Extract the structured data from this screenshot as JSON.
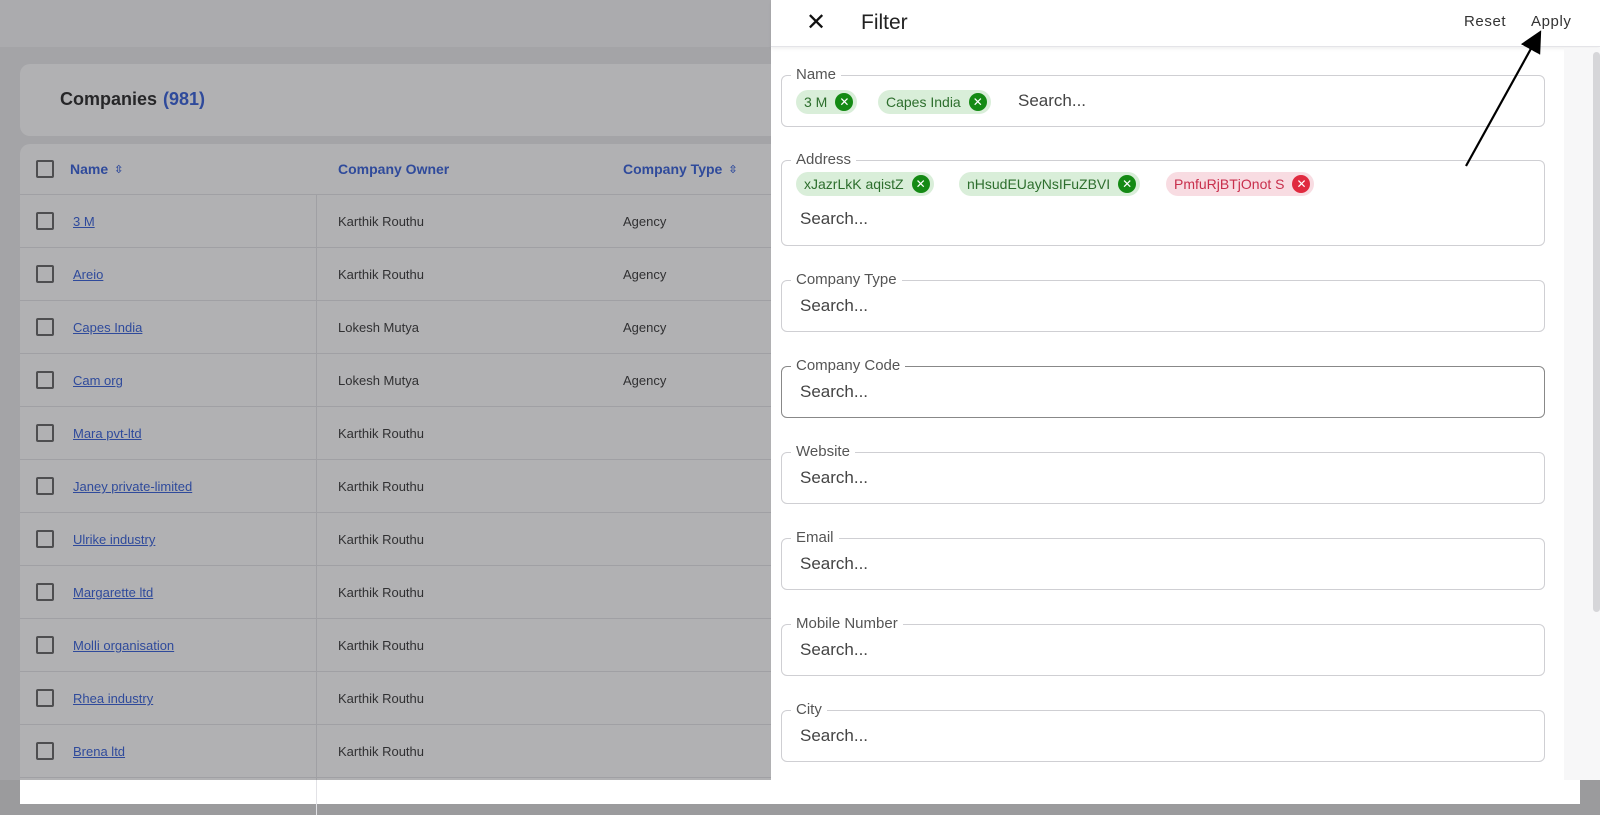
{
  "companies": {
    "title": "Companies",
    "count": "(981)",
    "columns": {
      "name": "Name",
      "owner": "Company Owner",
      "type": "Company Type"
    },
    "rows": [
      {
        "name": "3 M",
        "owner": "Karthik Routhu",
        "type": "Agency"
      },
      {
        "name": "Areio",
        "owner": "Karthik Routhu",
        "type": "Agency"
      },
      {
        "name": "Capes India",
        "owner": "Lokesh Mutya",
        "type": "Agency"
      },
      {
        "name": "Cam org",
        "owner": "Lokesh Mutya",
        "type": "Agency"
      },
      {
        "name": "Mara pvt-ltd",
        "owner": "Karthik Routhu",
        "type": ""
      },
      {
        "name": "Janey private-limited",
        "owner": "Karthik Routhu",
        "type": ""
      },
      {
        "name": "Ulrike industry",
        "owner": "Karthik Routhu",
        "type": ""
      },
      {
        "name": "Margarette ltd",
        "owner": "Karthik Routhu",
        "type": ""
      },
      {
        "name": "Molli organisation",
        "owner": "Karthik Routhu",
        "type": ""
      },
      {
        "name": "Rhea industry",
        "owner": "Karthik Routhu",
        "type": ""
      },
      {
        "name": "Brena ltd",
        "owner": "Karthik Routhu",
        "type": ""
      }
    ]
  },
  "filter": {
    "title": "Filter",
    "close_icon": "close-icon",
    "reset_label": "Reset",
    "apply_label": "Apply",
    "fields": {
      "name": {
        "label": "Name",
        "placeholder": "Search...",
        "chips": [
          "3 M",
          "Capes India"
        ]
      },
      "address": {
        "label": "Address",
        "placeholder": "Search...",
        "chips": [
          "xJazrLkK aqistZ",
          "nHsudEUayNsIFuZBVI",
          "PmfuRjBTjOnot S"
        ]
      },
      "company_type": {
        "label": "Company Type",
        "placeholder": "Search..."
      },
      "company_code": {
        "label": "Company Code",
        "placeholder": "Search..."
      },
      "website": {
        "label": "Website",
        "placeholder": "Search..."
      },
      "email": {
        "label": "Email",
        "placeholder": "Search..."
      },
      "mobile_number": {
        "label": "Mobile Number",
        "placeholder": "Search..."
      },
      "city": {
        "label": "City",
        "placeholder": "Search..."
      }
    }
  },
  "colors": {
    "accent_blue": "#1f4fd6",
    "chip_green_bg": "#d9eed9",
    "chip_green_icon": "#148a14",
    "chip_error_bg": "#f8dce2",
    "chip_error_icon": "#e02a3f"
  }
}
